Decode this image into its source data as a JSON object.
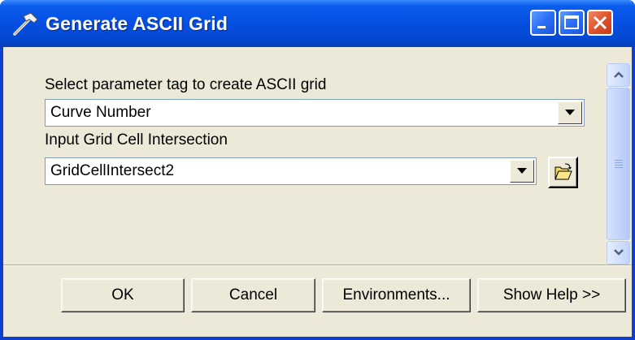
{
  "window": {
    "title": "Generate ASCII Grid"
  },
  "params": {
    "param1_label": "Select parameter tag to create ASCII grid",
    "param1_value": "Curve Number",
    "param2_label": "Input Grid Cell Intersection",
    "param2_value": "GridCellIntersect2"
  },
  "buttons": {
    "ok": "OK",
    "cancel": "Cancel",
    "environments": "Environments...",
    "show_help": "Show Help >>"
  },
  "icons": {
    "title_icon": "hammer-icon",
    "browse_icon": "open-folder-icon",
    "minimize": "minimize-icon",
    "maximize": "maximize-icon",
    "close": "close-icon"
  },
  "colors": {
    "titlebar": "#0650e3",
    "dialog_bg": "#ece9d8",
    "close_button": "#e0542c"
  }
}
